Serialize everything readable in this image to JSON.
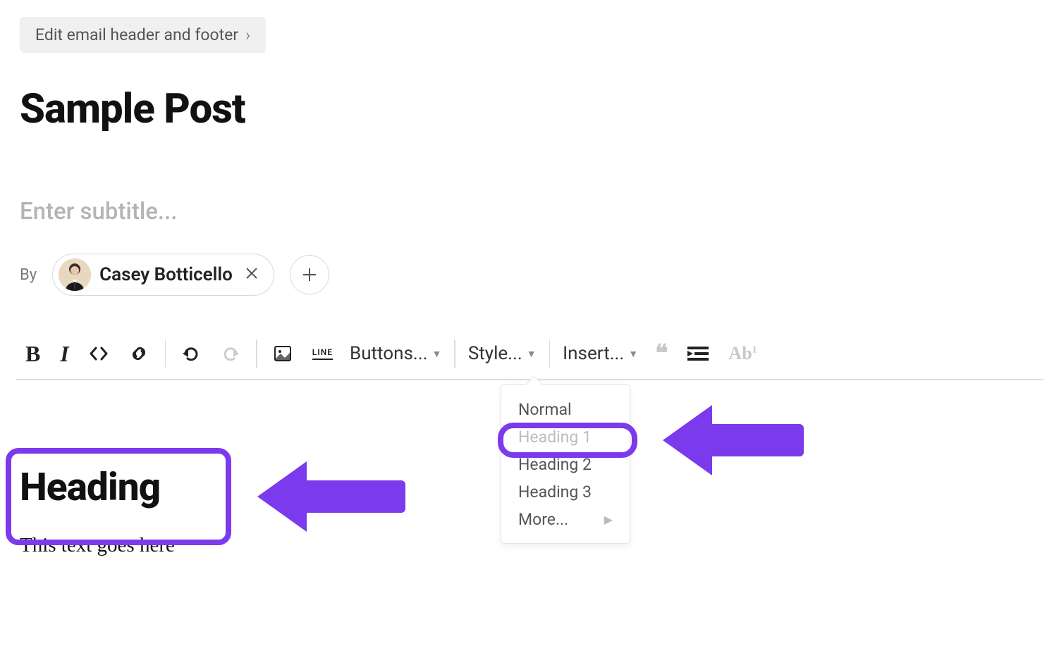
{
  "topLink": {
    "label": "Edit email header and footer"
  },
  "post": {
    "title": "Sample Post",
    "subtitlePlaceholder": "Enter subtitle...",
    "byLabel": "By",
    "author": "Casey Botticello"
  },
  "toolbar": {
    "buttonsLabel": "Buttons...",
    "styleLabel": "Style...",
    "insertLabel": "Insert...",
    "lineText": "LINE"
  },
  "styleDropdown": {
    "items": [
      "Normal",
      "Heading 1",
      "Heading 2",
      "Heading 3",
      "More..."
    ],
    "selected": "Heading 1"
  },
  "content": {
    "headingSample": "Heading",
    "bodyText": "This text goes here"
  },
  "annotationColor": "#7c3aed"
}
